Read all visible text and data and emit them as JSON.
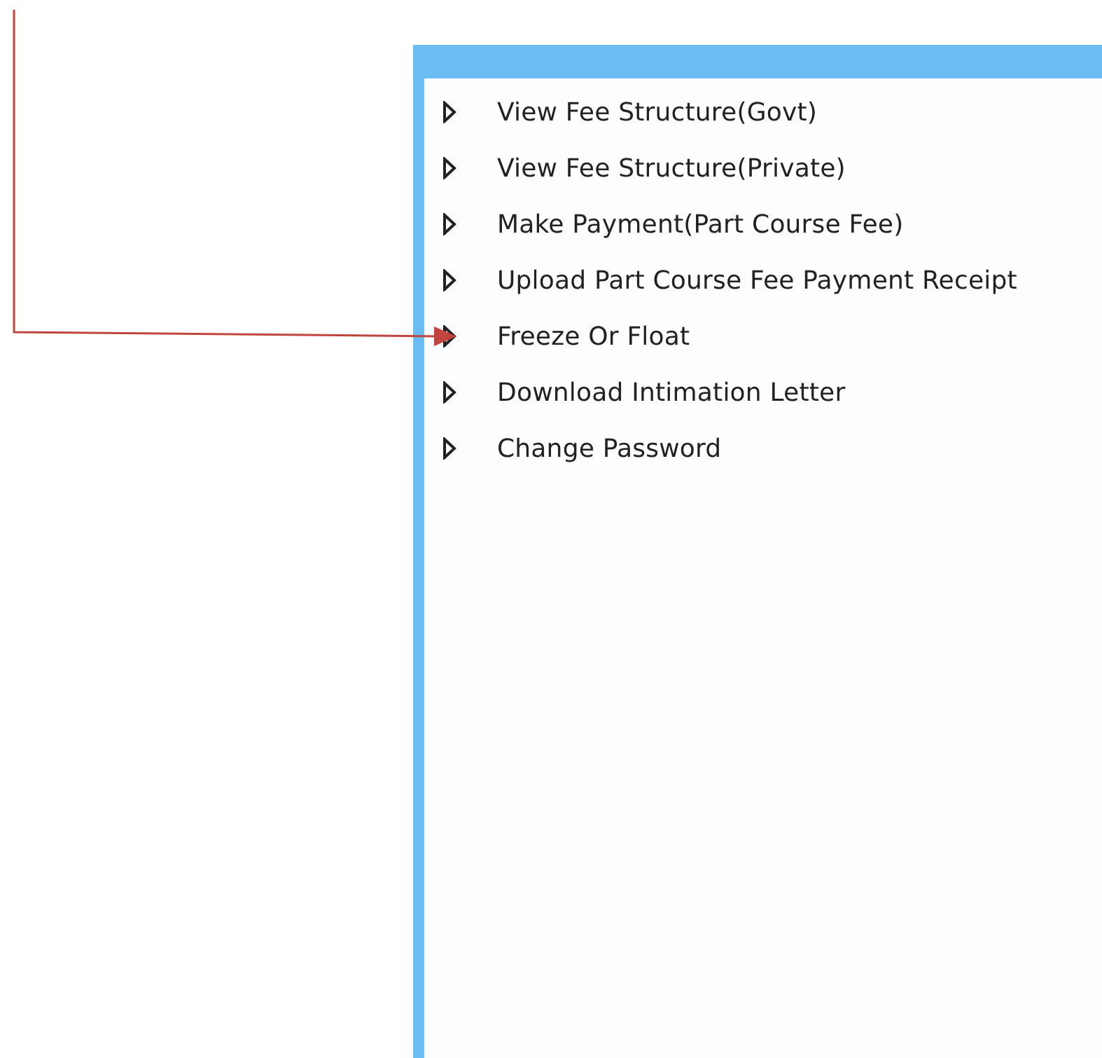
{
  "menu": {
    "items": [
      {
        "label": "View Fee Structure(Govt)"
      },
      {
        "label": "View Fee Structure(Private)"
      },
      {
        "label": "Make Payment(Part Course Fee)"
      },
      {
        "label": "Upload Part Course Fee Payment Receipt"
      },
      {
        "label": "Freeze Or Float"
      },
      {
        "label": "Download Intimation Letter"
      },
      {
        "label": "Change Password"
      }
    ]
  }
}
